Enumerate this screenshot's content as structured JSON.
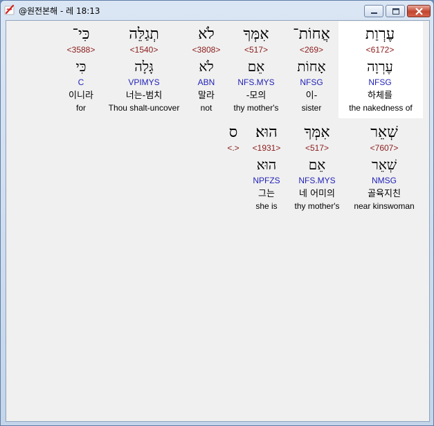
{
  "window": {
    "title": "@원전본해 - 레 18:13"
  },
  "row1": [
    {
      "heb": "עֶרְוַת",
      "strong": "<6172>",
      "lemma": "עֶרְוָה",
      "morph": "NFSG",
      "kor": "하체를",
      "eng": "the nakedness of",
      "highlighted": true
    },
    {
      "heb": "אֲחוֹת־",
      "strong": "<269>",
      "lemma": "אָחוֹת",
      "morph": "NFSG",
      "kor": "이-",
      "eng": "sister"
    },
    {
      "heb": "אִמְּךָ",
      "strong": "<517>",
      "lemma": "אֵם",
      "morph": "NFS.MYS",
      "kor": "-모의",
      "eng": "thy mother's"
    },
    {
      "heb": "לֹא",
      "strong": "<3808>",
      "lemma": "לֹא",
      "morph": "ABN",
      "kor": "말라",
      "eng": "not"
    },
    {
      "heb": "תְגַלֵּה",
      "strong": "<1540>",
      "lemma": "גָּלָה",
      "morph": "VPIMYS",
      "kor": "너는-범치",
      "eng": "Thou shalt-uncover"
    },
    {
      "heb": "כִּי־",
      "strong": "<3588>",
      "lemma": "כִּי",
      "morph": "C",
      "kor": "이니라",
      "eng": "for"
    }
  ],
  "row2": [
    {
      "heb": "שְׁאֵר",
      "strong": "<7607>",
      "lemma": "שְׁאֵר",
      "morph": "NMSG",
      "kor": "골육지친",
      "eng": "near kinswoman"
    },
    {
      "heb": "אִמְּךָ",
      "strong": "<517>",
      "lemma": "אֵם",
      "morph": "NFS.MYS",
      "kor": "네 어미의",
      "eng": "thy mother's"
    },
    {
      "heb": "הוּא׃",
      "strong": "<1931>",
      "lemma": "הוּא",
      "morph": "NPFZS",
      "kor": "그는",
      "eng": "she is"
    },
    {
      "heb": "ס",
      "strong": "<.>"
    }
  ]
}
